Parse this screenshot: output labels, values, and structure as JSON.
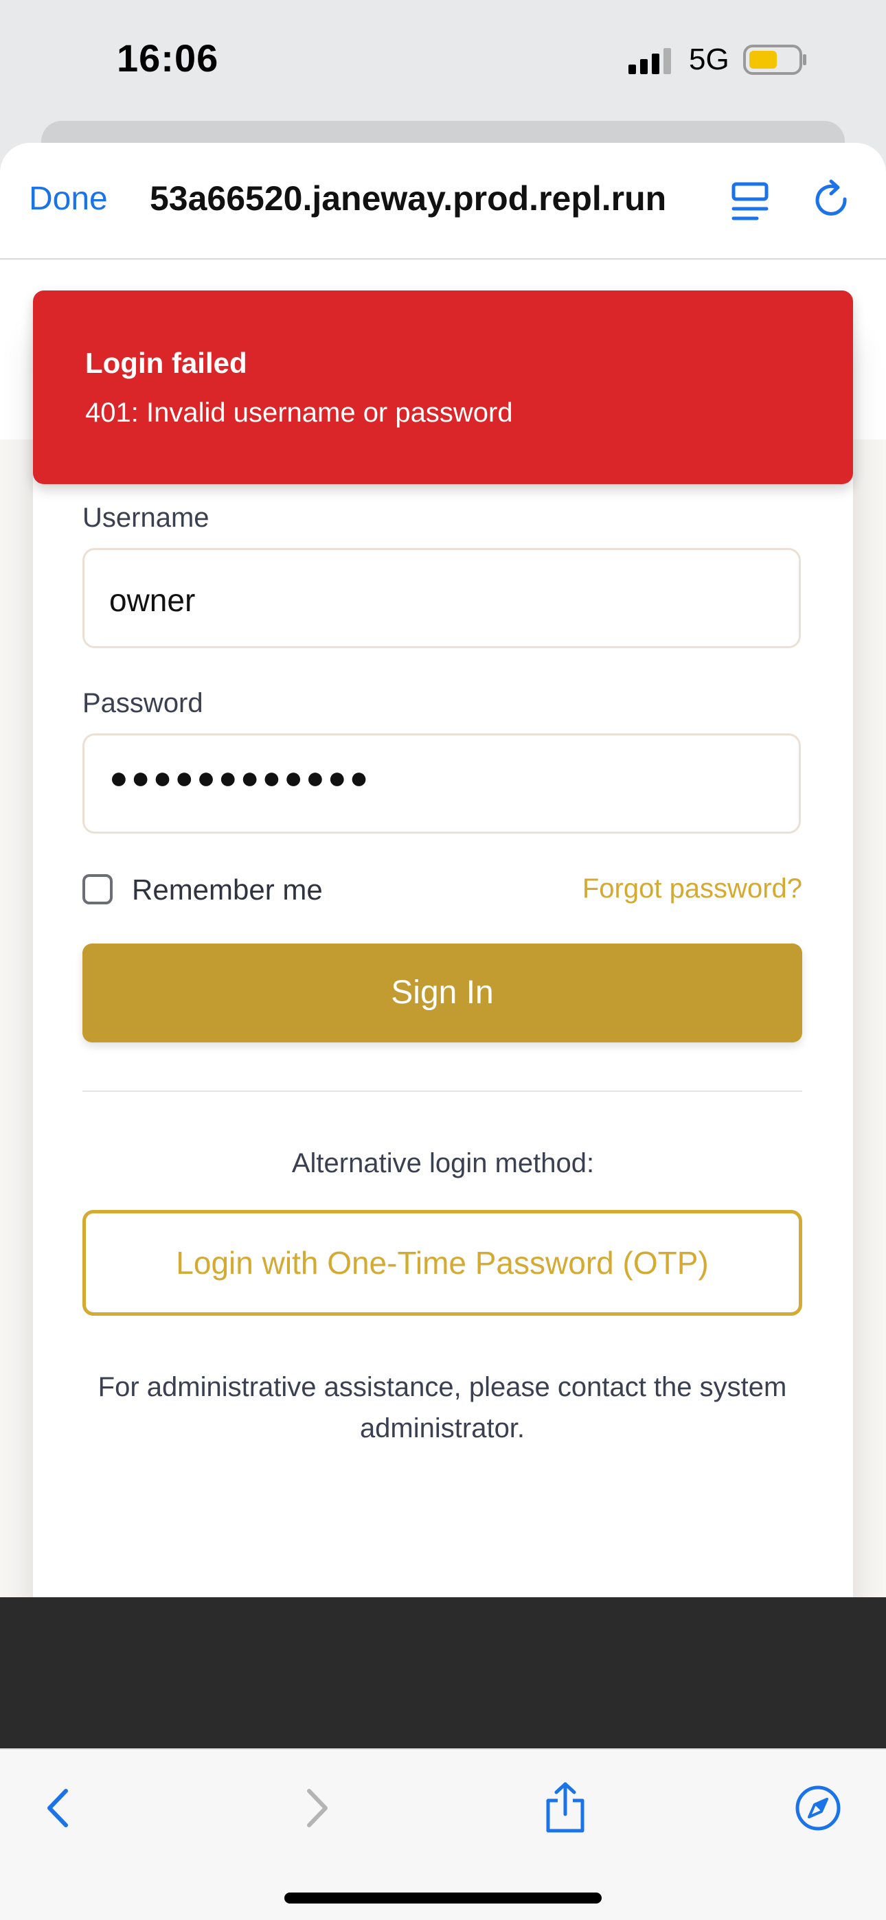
{
  "status": {
    "time": "16:06",
    "network": "5G",
    "battery_color": "#f5c400"
  },
  "browser": {
    "done_label": "Done",
    "url": "53a66520.janeway.prod.repl.run"
  },
  "toast": {
    "title": "Login failed",
    "message": "401: Invalid username or password",
    "color": "#da2628"
  },
  "form": {
    "username_label": "Username",
    "username_value": "owner",
    "password_label": "Password",
    "password_masked": "●●●●●●●●●●●●",
    "remember_label": "Remember me",
    "remember_checked": false,
    "forgot_label": "Forgot password?",
    "signin_label": "Sign In",
    "alt_label": "Alternative login method:",
    "otp_label": "Login with One-Time Password (OTP)",
    "assist_text": "For administrative assistance, please contact the system administrator."
  },
  "colors": {
    "accent": "#c29c31",
    "link": "#d4aa33",
    "ios_blue": "#1a73e8"
  }
}
